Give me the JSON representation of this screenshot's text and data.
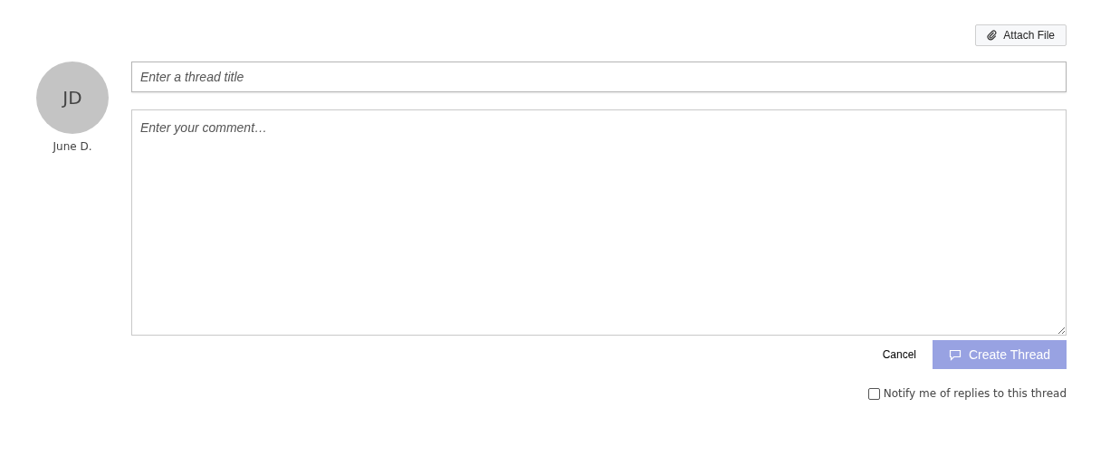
{
  "attach_button": {
    "label": "Attach File"
  },
  "author": {
    "initials": "JD",
    "name": "June D."
  },
  "title_field": {
    "placeholder": "Enter a thread title"
  },
  "comment_field": {
    "placeholder": "Enter your comment…"
  },
  "cancel_button": {
    "label": "Cancel"
  },
  "create_button": {
    "label": "Create Thread",
    "disabled": true
  },
  "notify": {
    "label": "Notify me of replies to this thread",
    "checked": false
  }
}
